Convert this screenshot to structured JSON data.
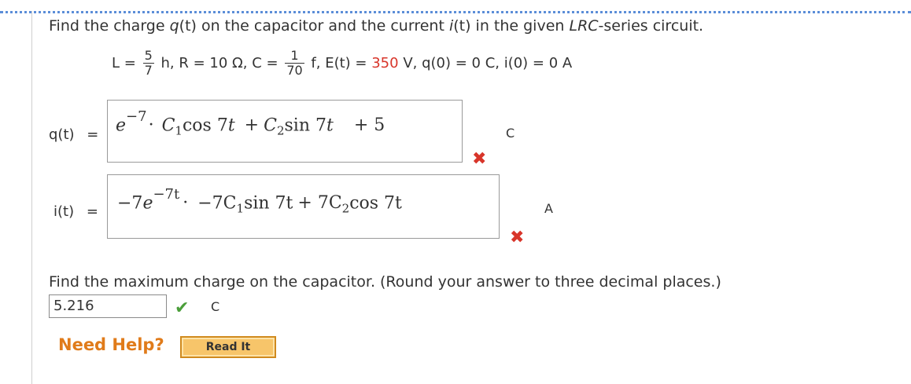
{
  "question": {
    "prefix": "Find the charge ",
    "q_sym": "q",
    "q_arg": "(t)",
    "middle": " on the capacitor and the current ",
    "i_sym": "i",
    "i_arg": "(t)",
    "middle2": " in the given ",
    "circuit": "LRC",
    "suffix": "-series circuit."
  },
  "params": {
    "L_label": "L =",
    "L_num": "5",
    "L_den": "7",
    "after_L": "h, R = 10 Ω, C =",
    "C_num": "1",
    "C_den": "70",
    "after_C": "f, E(t) =",
    "E_value": "350",
    "after_E": "V, q(0) = 0 C, i(0) = 0 A"
  },
  "q_answer": {
    "label": "q(t)",
    "equals": "=",
    "expr_base": "e",
    "expr_exp": "−7",
    "expr_dot": "·",
    "term1_coef": "C",
    "term1_sub": "1",
    "term1_fn": "cos 7",
    "term1_var": "t",
    "plus1": "+",
    "term2_coef": "C",
    "term2_sub": "2",
    "term2_fn": "sin 7",
    "term2_var": "t",
    "plus_const": "+ 5",
    "unit": "C",
    "status": "incorrect"
  },
  "i_answer": {
    "label": "i(t)",
    "equals": "=",
    "lead": "−7",
    "expr_base": "e",
    "expr_exp": "−7t",
    "expr_dot": "·",
    "term1": "−7C",
    "term1_sub": "1",
    "term1_fn": "sin 7t",
    "plus": "+ 7C",
    "term2_sub": "2",
    "term2_fn": "cos 7t",
    "unit": "A",
    "status": "incorrect"
  },
  "max_charge": {
    "prompt": "Find the maximum charge on the capacitor. (Round your answer to three decimal places.)",
    "value": "5.216",
    "unit": "C",
    "status": "correct"
  },
  "help": {
    "label": "Need Help?",
    "button": "Read It"
  },
  "colors": {
    "accent_red": "#d8352a",
    "correct_green": "#4a9e3a",
    "help_orange": "#e07b1a",
    "button_fill": "#f7c56a",
    "dotted_border": "#5b8ed8"
  }
}
